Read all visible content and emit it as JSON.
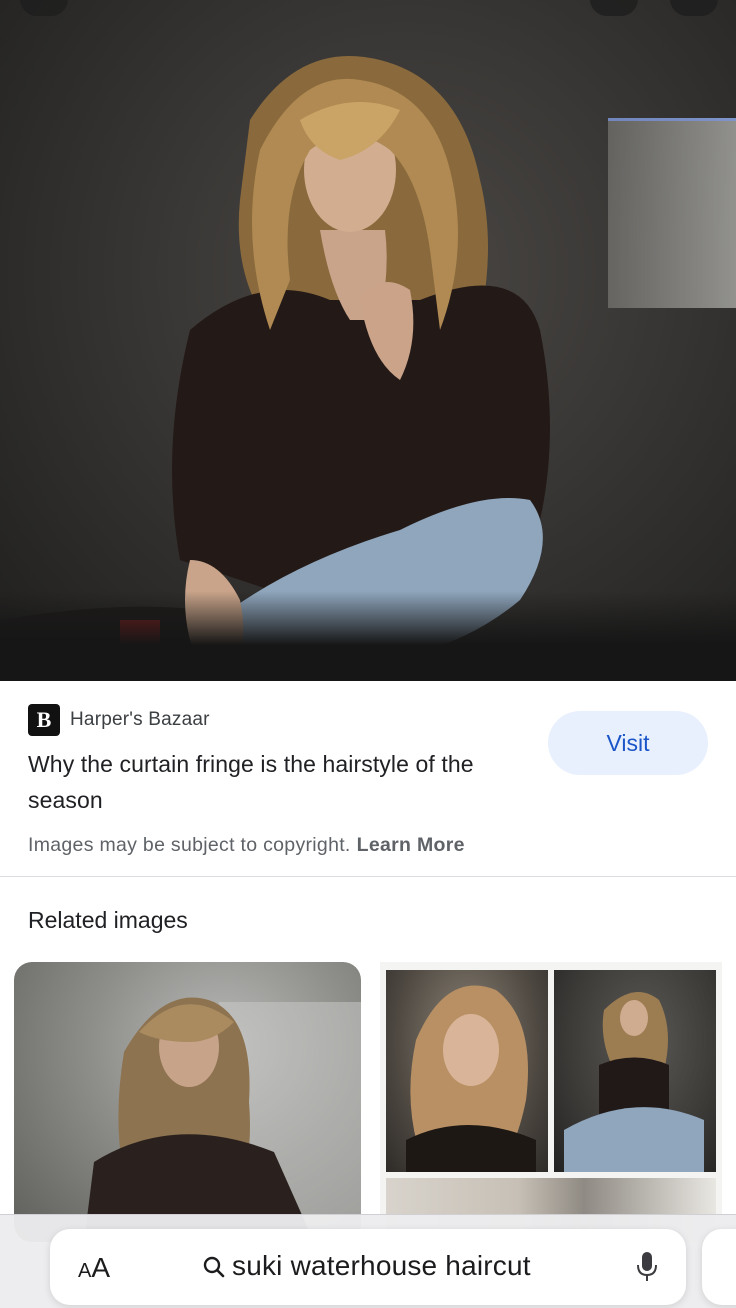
{
  "result": {
    "source_name": "Harper's Bazaar",
    "source_logo_letter": "B",
    "title": "Why the curtain fringe is the hairstyle of the season",
    "visit_label": "Visit",
    "copyright_text": "Images may be subject to copyright.",
    "learn_more_label": "Learn More"
  },
  "related": {
    "heading": "Related images"
  },
  "browser": {
    "text_size_label_big": "A",
    "text_size_label_small": "A",
    "search_query": "suki waterhouse haircut"
  },
  "colors": {
    "visit_bg": "#e8f0fe",
    "visit_text": "#1a56c8",
    "divider": "#dadce0"
  },
  "icons": [
    "search-icon",
    "microphone-icon",
    "harpers-bazaar-logo"
  ]
}
